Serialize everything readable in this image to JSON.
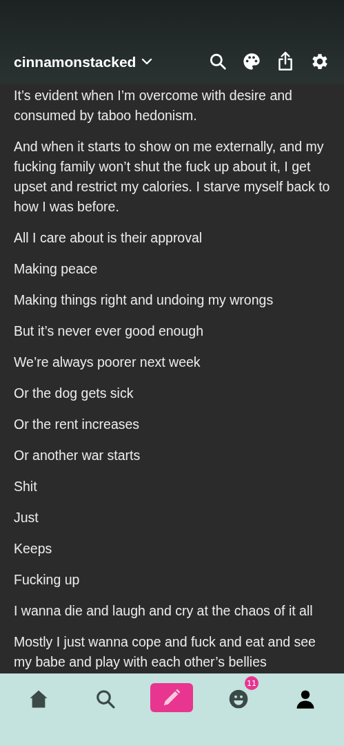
{
  "header": {
    "blog_name": "cinnamonstacked"
  },
  "post": {
    "paragraphs": [
      "It’s evident when I’m overcome with desire and consumed by taboo hedonism.",
      "And when it starts to show on me externally, and my fucking family won’t shut the fuck up about it, I get upset and restrict my calories. I starve myself back to how I was before.",
      "All I care about is their approval",
      "Making peace",
      "Making things right and undoing my wrongs",
      "But it’s never ever good enough",
      "We’re always poorer next week",
      "Or the dog gets sick",
      "Or the rent increases",
      "Or another war starts",
      "Shit",
      "Just",
      "Keeps",
      "Fucking up",
      "I wanna die and laugh and cry at the chaos of it all",
      "Mostly I just wanna cope and fuck and eat and see my babe and play with each other’s bellies"
    ]
  },
  "tab_bar": {
    "items": [
      {
        "kind": "home",
        "selected": false
      },
      {
        "kind": "search",
        "selected": false
      },
      {
        "kind": "compose",
        "selected": false
      },
      {
        "kind": "activity",
        "selected": false,
        "badge": "11"
      },
      {
        "kind": "account",
        "selected": true
      }
    ]
  }
}
